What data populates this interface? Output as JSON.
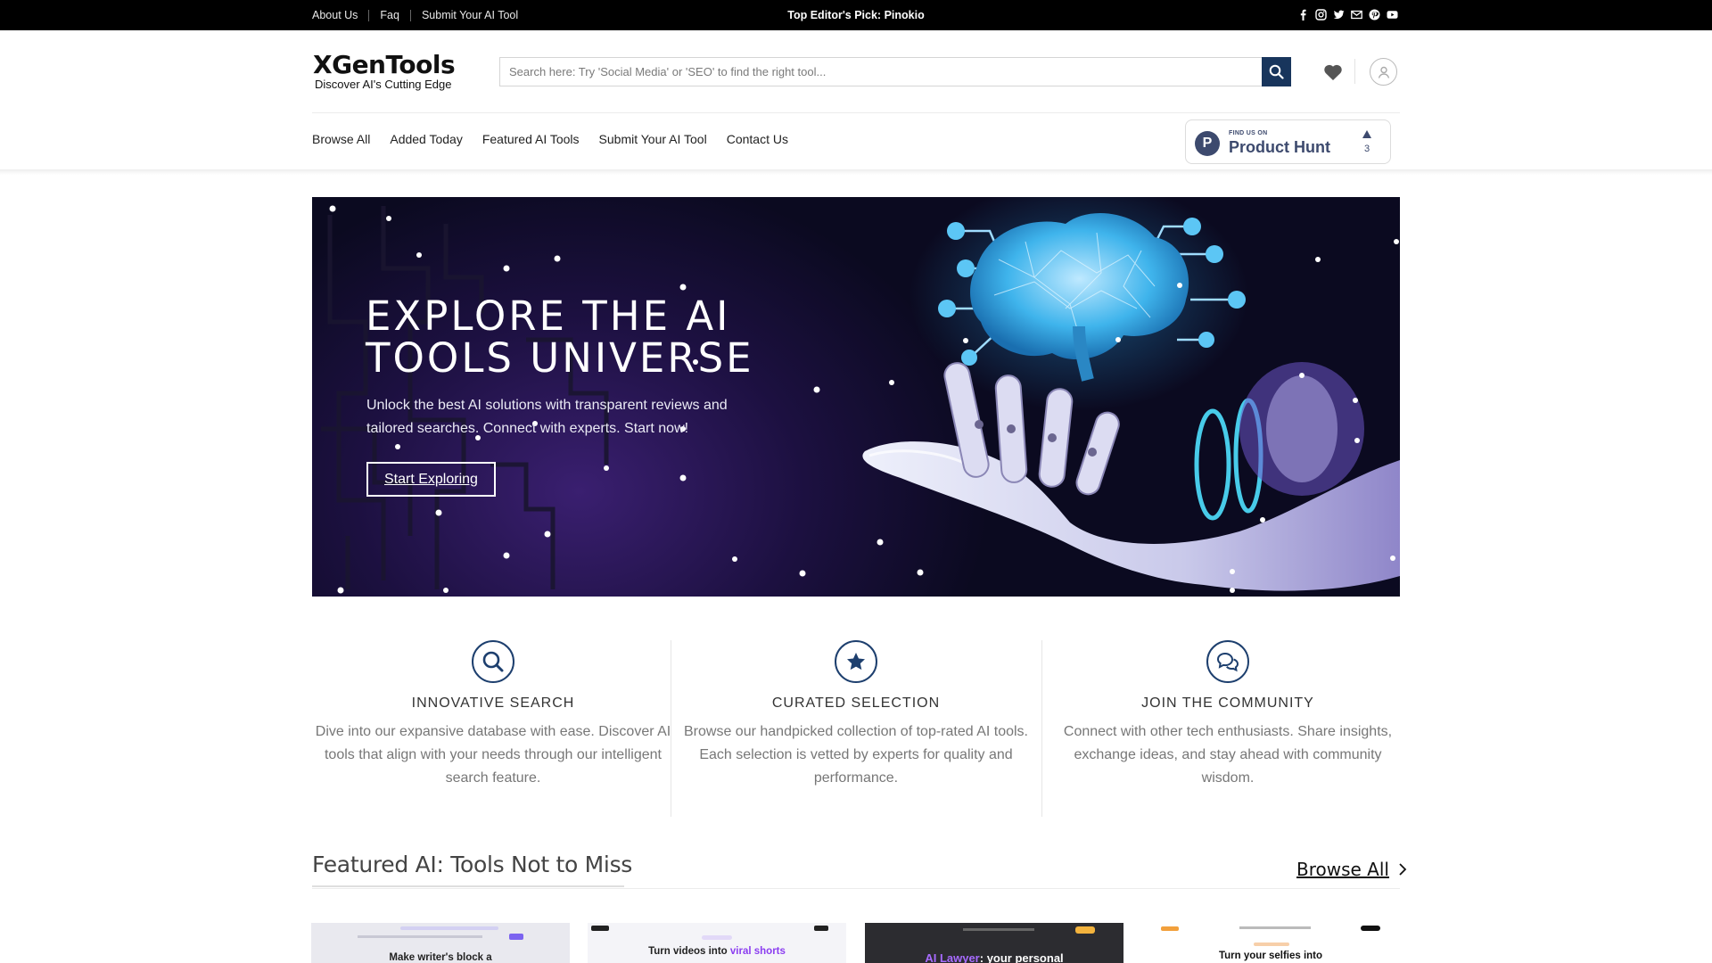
{
  "topbar": {
    "links": [
      "About Us",
      "Faq",
      "Submit Your AI Tool"
    ],
    "editor_pick": "Top Editor's Pick: Pinokio",
    "social_icons": [
      "facebook-icon",
      "instagram-icon",
      "twitter-icon",
      "email-icon",
      "pinterest-icon",
      "youtube-icon"
    ]
  },
  "header": {
    "logo_name": "XGenTools",
    "logo_tagline": "Discover AI's Cutting Edge",
    "search_placeholder": "Search here: Try 'Social Media' or 'SEO' to find the right tool...",
    "search_value": ""
  },
  "nav": {
    "items": [
      "Browse All",
      "Added Today",
      "Featured AI Tools",
      "Submit Your AI Tool",
      "Contact Us"
    ]
  },
  "product_hunt": {
    "find_label": "FIND US ON",
    "title": "Product Hunt",
    "votes": "3"
  },
  "hero": {
    "heading": "EXPLORE THE AI TOOLS UNIVERSE",
    "subtext": "Unlock the best AI solutions with transparent reviews and tailored searches. Connect with experts. Start now!",
    "cta": "Start Exploring"
  },
  "features": [
    {
      "icon": "search-icon",
      "title": "INNOVATIVE SEARCH",
      "desc": "Dive into our expansive database with ease. Discover AI tools that align with your needs through our intelligent search feature."
    },
    {
      "icon": "star-icon",
      "title": "CURATED SELECTION",
      "desc": "Browse our handpicked collection of top-rated AI tools. Each selection is vetted by experts for quality and performance."
    },
    {
      "icon": "chat-icon",
      "title": "JOIN THE COMMUNITY",
      "desc": "Connect with other tech enthusiasts. Share insights, exchange ideas, and stay ahead with community wisdom."
    }
  ],
  "featured": {
    "heading": "Featured AI: Tools Not to Miss",
    "browse_all": "Browse All",
    "cards": [
      {
        "caption": "Make writer's block a"
      },
      {
        "caption_pre": "Turn videos into ",
        "caption_hl": "viral shorts"
      },
      {
        "caption_hl": "AI Lawyer",
        "caption_post": ": your personal"
      },
      {
        "caption": "Turn your selfies into"
      }
    ]
  },
  "colors": {
    "accent": "#18355c",
    "icon_stroke": "#1d3f6e",
    "highlight_purple": "#8b3df0"
  }
}
